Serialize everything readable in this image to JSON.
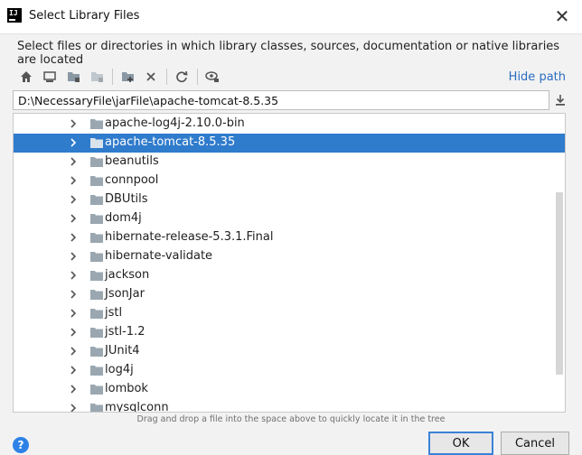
{
  "window": {
    "title": "Select Library Files",
    "app_icon": "intellij-icon"
  },
  "description": "Select files or directories in which library classes, sources, documentation or native libraries are located",
  "toolbar": {
    "buttons": [
      "home-icon",
      "desktop-icon",
      "project-folder-icon",
      "module-folder-icon",
      "new-folder-icon",
      "delete-icon",
      "refresh-icon",
      "show-hidden-icon"
    ],
    "hide_path_label": "Hide path"
  },
  "path": {
    "value": "D:\\NecessaryFile\\jarFile\\apache-tomcat-8.5.35"
  },
  "tree": {
    "selected_index": 1,
    "items": [
      {
        "label": "apache-log4j-2.10.0-bin"
      },
      {
        "label": "apache-tomcat-8.5.35"
      },
      {
        "label": "beanutils"
      },
      {
        "label": "connpool"
      },
      {
        "label": "DBUtils"
      },
      {
        "label": "dom4j"
      },
      {
        "label": "hibernate-release-5.3.1.Final"
      },
      {
        "label": "hibernate-validate"
      },
      {
        "label": "jackson"
      },
      {
        "label": "JsonJar"
      },
      {
        "label": "jstl"
      },
      {
        "label": "jstl-1.2"
      },
      {
        "label": "JUnit4"
      },
      {
        "label": "log4j"
      },
      {
        "label": "lombok"
      },
      {
        "label": "mysqlconn"
      }
    ]
  },
  "hint": "Drag and drop a file into the space above to quickly locate it in the tree",
  "buttons": {
    "ok": "OK",
    "cancel": "Cancel",
    "help": "?"
  },
  "colors": {
    "selection": "#2f7bcc",
    "link": "#2a6cc0",
    "folder": "#9aa7b0"
  }
}
